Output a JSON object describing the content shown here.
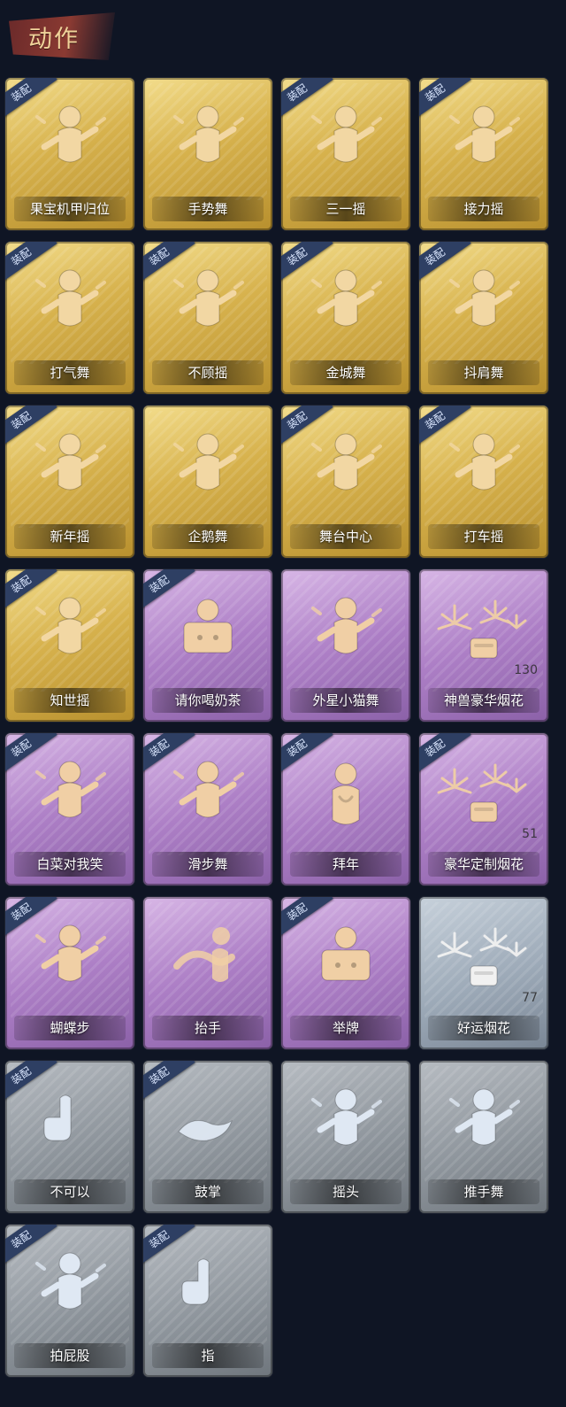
{
  "header": {
    "title": "动作"
  },
  "equip_label": "装配",
  "colors": {
    "gold": "#d7b24d",
    "purple": "#ad7fc6",
    "silver": "#9daab8",
    "gray": "#8f969d",
    "equip_badge": "#2e3f63"
  },
  "cards": [
    {
      "label": "果宝机甲归位",
      "tier": "gold",
      "equipped": true,
      "icon": "dance-figure-icon"
    },
    {
      "label": "手势舞",
      "tier": "gold",
      "equipped": false,
      "icon": "dance-figure-icon"
    },
    {
      "label": "三一摇",
      "tier": "gold",
      "equipped": true,
      "icon": "dance-figure-icon"
    },
    {
      "label": "接力摇",
      "tier": "gold",
      "equipped": true,
      "icon": "dance-figure-icon"
    },
    {
      "label": "打气舞",
      "tier": "gold",
      "equipped": true,
      "icon": "dance-figure-icon"
    },
    {
      "label": "不顾摇",
      "tier": "gold",
      "equipped": true,
      "icon": "dance-figure-icon"
    },
    {
      "label": "金城舞",
      "tier": "gold",
      "equipped": true,
      "icon": "dance-figure-icon"
    },
    {
      "label": "抖肩舞",
      "tier": "gold",
      "equipped": true,
      "icon": "dance-figure-icon"
    },
    {
      "label": "新年摇",
      "tier": "gold",
      "equipped": true,
      "icon": "dance-figure-icon"
    },
    {
      "label": "企鹅舞",
      "tier": "gold",
      "equipped": false,
      "icon": "dance-figure-icon"
    },
    {
      "label": "舞台中心",
      "tier": "gold",
      "equipped": true,
      "icon": "dance-figure-icon"
    },
    {
      "label": "打车摇",
      "tier": "gold",
      "equipped": true,
      "icon": "dance-figure-icon"
    },
    {
      "label": "知世摇",
      "tier": "gold",
      "equipped": true,
      "icon": "dance-figure-icon"
    },
    {
      "label": "请你喝奶茶",
      "tier": "purple",
      "equipped": true,
      "icon": "sign-figure-icon"
    },
    {
      "label": "外星小猫舞",
      "tier": "purple",
      "equipped": false,
      "icon": "dance-figure-icon"
    },
    {
      "label": "神兽豪华烟花",
      "tier": "purple",
      "equipped": false,
      "icon": "fireworks-icon",
      "count": "130"
    },
    {
      "label": "白菜对我笑",
      "tier": "purple",
      "equipped": true,
      "icon": "dance-figure-icon"
    },
    {
      "label": "滑步舞",
      "tier": "purple",
      "equipped": true,
      "icon": "dance-figure-icon"
    },
    {
      "label": "拜年",
      "tier": "purple",
      "equipped": true,
      "icon": "bow-figure-icon"
    },
    {
      "label": "豪华定制烟花",
      "tier": "purple",
      "equipped": true,
      "icon": "fireworks-icon",
      "count": "51"
    },
    {
      "label": "蝴蝶步",
      "tier": "purple",
      "equipped": true,
      "icon": "dance-figure-icon"
    },
    {
      "label": "抬手",
      "tier": "purple",
      "equipped": false,
      "icon": "hand-figure-icon"
    },
    {
      "label": "举牌",
      "tier": "purple",
      "equipped": true,
      "icon": "sign-figure-icon"
    },
    {
      "label": "好运烟花",
      "tier": "silver",
      "equipped": false,
      "icon": "fireworks-icon",
      "count": "77"
    },
    {
      "label": "不可以",
      "tier": "gray",
      "equipped": true,
      "icon": "finger-icon"
    },
    {
      "label": "鼓掌",
      "tier": "gray",
      "equipped": true,
      "icon": "clap-icon"
    },
    {
      "label": "摇头",
      "tier": "gray",
      "equipped": false,
      "icon": "dance-figure-icon"
    },
    {
      "label": "推手舞",
      "tier": "gray",
      "equipped": false,
      "icon": "dance-figure-icon"
    },
    {
      "label": "拍屁股",
      "tier": "gray",
      "equipped": true,
      "icon": "dance-figure-icon"
    },
    {
      "label": "指",
      "tier": "gray",
      "equipped": true,
      "icon": "pointing-hand-icon"
    }
  ]
}
